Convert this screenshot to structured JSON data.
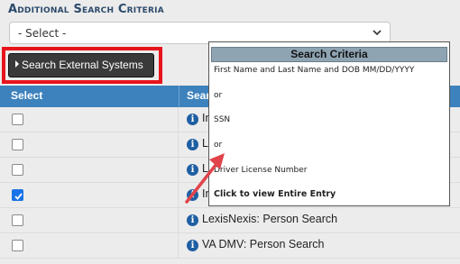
{
  "section": {
    "title": "Additional Search Criteria"
  },
  "select": {
    "value": "- Select -"
  },
  "toolbar": {
    "search_external_label": "Search External Systems"
  },
  "grid": {
    "columns": [
      "Select",
      "Search"
    ],
    "rows": [
      {
        "name": "In",
        "checked": false
      },
      {
        "name": "LL",
        "checked": false
      },
      {
        "name": "Lo",
        "checked": false
      },
      {
        "name": "In",
        "checked": true
      },
      {
        "name": "LexisNexis: Person Search",
        "checked": false
      },
      {
        "name": "VA DMV: Person Search",
        "checked": false
      }
    ]
  },
  "popup": {
    "title": "Search Criteria",
    "lines": [
      "First Name and Last Name and DOB MM/DD/YYYY",
      "or",
      "SSN",
      "or",
      "Driver License Number"
    ],
    "footer": "Click to view Entire Entry"
  },
  "colors": {
    "header_blue": "#3d82bd",
    "highlight_red": "#e8141c",
    "checkbox_blue": "#1a73e8"
  },
  "icons": [
    "chevron-down-icon",
    "play-triangle-icon",
    "info-icon",
    "checkmark-icon",
    "red-arrow-annotation"
  ]
}
